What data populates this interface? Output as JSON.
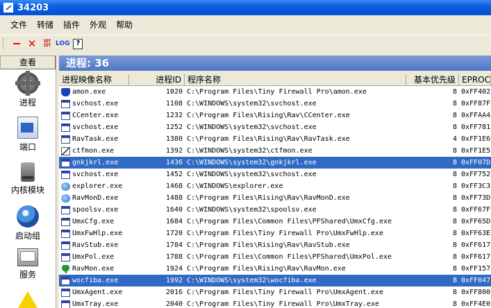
{
  "window": {
    "title": "34203"
  },
  "menu": [
    "文件",
    "转储",
    "插件",
    "外观",
    "帮助"
  ],
  "toolbar": {
    "log_label": "LOG",
    "sdt_label_top": "SDT",
    "sdt_label_bottom": "IDT",
    "help_label": "?"
  },
  "sidebar": {
    "header": "查看",
    "items": [
      {
        "label": "进程",
        "icon": "gear-icon"
      },
      {
        "label": "端口",
        "icon": "port-icon"
      },
      {
        "label": "内核模块",
        "icon": "kernel-module-icon"
      },
      {
        "label": "启动组",
        "icon": "startup-icon"
      },
      {
        "label": "服务",
        "icon": "service-icon"
      },
      {
        "label": "",
        "icon": "warning-icon"
      }
    ]
  },
  "main": {
    "header": "进程: 36"
  },
  "table": {
    "columns": [
      "进程映像名称",
      "进程ID",
      "程序名称",
      "基本优先级",
      "EPROCESS"
    ],
    "rows": [
      {
        "name": "amon.exe",
        "pid": "1020",
        "path": "C:\\Program Files\\Tiny Firewall Pro\\amon.exe",
        "prio": "8",
        "eproc": "0xFF402",
        "icon": "shield",
        "sel": false
      },
      {
        "name": "svchost.exe",
        "pid": "1108",
        "path": "C:\\WINDOWS\\system32\\svchost.exe",
        "prio": "8",
        "eproc": "0xFF87F",
        "icon": "win",
        "sel": false
      },
      {
        "name": "CCenter.exe",
        "pid": "1232",
        "path": "C:\\Program Files\\Rising\\Rav\\CCenter.exe",
        "prio": "8",
        "eproc": "0xFFAA4",
        "icon": "win",
        "sel": false
      },
      {
        "name": "svchost.exe",
        "pid": "1252",
        "path": "C:\\WINDOWS\\system32\\svchost.exe",
        "prio": "8",
        "eproc": "0xFF781",
        "icon": "win",
        "sel": false
      },
      {
        "name": "RavTask.exe",
        "pid": "1380",
        "path": "C:\\Program Files\\Rising\\Rav\\RavTask.exe",
        "prio": "4",
        "eproc": "0xFF1E6",
        "icon": "win",
        "sel": false
      },
      {
        "name": "ctfmon.exe",
        "pid": "1392",
        "path": "C:\\WINDOWS\\system32\\ctfmon.exe",
        "prio": "8",
        "eproc": "0xFF1E5",
        "icon": "pen",
        "sel": false
      },
      {
        "name": "gnkjkrl.exe",
        "pid": "1436",
        "path": "C:\\WINDOWS\\system32\\gnkjkrl.exe",
        "prio": "8",
        "eproc": "0xFF07D",
        "icon": "win",
        "sel": true
      },
      {
        "name": "svchost.exe",
        "pid": "1452",
        "path": "C:\\WINDOWS\\system32\\svchost.exe",
        "prio": "8",
        "eproc": "0xFF752",
        "icon": "win",
        "sel": false
      },
      {
        "name": "explorer.exe",
        "pid": "1468",
        "path": "C:\\WINDOWS\\explorer.exe",
        "prio": "8",
        "eproc": "0xFF3C3",
        "icon": "globe",
        "sel": false
      },
      {
        "name": "RavMonD.exe",
        "pid": "1488",
        "path": "C:\\Program Files\\Rising\\Rav\\RavMonD.exe",
        "prio": "8",
        "eproc": "0xFF73D",
        "icon": "globe",
        "sel": false
      },
      {
        "name": "spoolsv.exe",
        "pid": "1640",
        "path": "C:\\WINDOWS\\system32\\spoolsv.exe",
        "prio": "8",
        "eproc": "0xFF67F",
        "icon": "win",
        "sel": false
      },
      {
        "name": "UmxCfg.exe",
        "pid": "1684",
        "path": "C:\\Program Files\\Common Files\\PFShared\\UmxCfg.exe",
        "prio": "8",
        "eproc": "0xFF65D",
        "icon": "win",
        "sel": false
      },
      {
        "name": "UmxFwHlp.exe",
        "pid": "1720",
        "path": "C:\\Program Files\\Tiny Firewall Pro\\UmxFwHlp.exe",
        "prio": "8",
        "eproc": "0xFF63E",
        "icon": "win",
        "sel": false
      },
      {
        "name": "RavStub.exe",
        "pid": "1784",
        "path": "C:\\Program Files\\Rising\\Rav\\RavStub.exe",
        "prio": "8",
        "eproc": "0xFF617",
        "icon": "win",
        "sel": false
      },
      {
        "name": "UmxPol.exe",
        "pid": "1788",
        "path": "C:\\Program Files\\Common Files\\PFShared\\UmxPol.exe",
        "prio": "8",
        "eproc": "0xFF617",
        "icon": "win",
        "sel": false
      },
      {
        "name": "RavMon.exe",
        "pid": "1924",
        "path": "C:\\Program Files\\Rising\\Rav\\RavMon.exe",
        "prio": "8",
        "eproc": "0xFF157",
        "icon": "tree",
        "sel": false
      },
      {
        "name": "wocfiba.exe",
        "pid": "1992",
        "path": "C:\\WINDOWS\\system32\\wocfiba.exe",
        "prio": "8",
        "eproc": "0xFF047",
        "icon": "win",
        "sel": true
      },
      {
        "name": "UmxAgent.exe",
        "pid": "2016",
        "path": "C:\\Program Files\\Tiny Firewall Pro\\UmxAgent.exe",
        "prio": "8",
        "eproc": "0xFF800",
        "icon": "win",
        "sel": false
      },
      {
        "name": "UmxTray.exe",
        "pid": "2040",
        "path": "C:\\Program Files\\Tiny Firewall Pro\\UmxTray.exe",
        "prio": "8",
        "eproc": "0xFF4E0",
        "icon": "win",
        "sel": false
      }
    ]
  }
}
